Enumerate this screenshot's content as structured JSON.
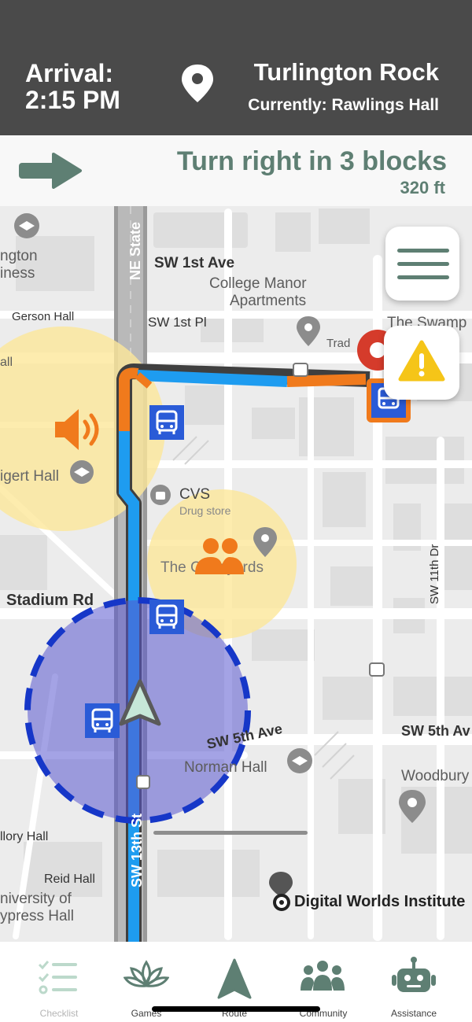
{
  "header": {
    "arrival_label": "Arrival:",
    "arrival_time": "2:15 PM",
    "destination": "Turlington Rock",
    "current": "Currently: Rawlings Hall"
  },
  "instruction": {
    "text": "Turn right in 3 blocks",
    "distance": "320 ft"
  },
  "map": {
    "labels": {
      "ne_state": "NE State",
      "sw_1st_ave": "SW 1st Ave",
      "college_manor_1": "College Manor",
      "college_manor_2": "Apartments",
      "gerson_hall": "Gerson Hall",
      "sw_1st_pl": "SW 1st Pl",
      "the_swamp": "The Swamp",
      "trad": "Trad",
      "cvs": "CVS",
      "drug_store": "Drug store",
      "the_courtyards": "The Courtyards",
      "stadium_rd": "Stadium Rd",
      "sw_11th_dr": "SW 11th Dr",
      "sw_5th_ave_a": "SW 5th Ave",
      "sw_5th_ave_b": "SW 5th Av",
      "norman_hall": "Norman Hall",
      "woodbury": "Woodbury",
      "sw_13th_st": "SW 13th St",
      "mallory_hall": "llory Hall",
      "reid_hall": "Reid Hall",
      "univ_1": "niversity of",
      "univ_2": "ypress Hall",
      "digital_worlds": "Digital Worlds Institute",
      "ington": "ngton",
      "iness": "iness",
      "all": "all",
      "igert_hall": "igert Hall"
    },
    "colors": {
      "route_blue": "#1e9cf0",
      "route_orange": "#f07a1c",
      "bus_blue": "#2a5bd7",
      "sound_zone": "#fde79a",
      "crowd_zone": "#fde79a",
      "user_zone": "#6b68d8",
      "accent": "#5e7f73",
      "warning": "#f5c518"
    },
    "icons": [
      "sound-icon",
      "crowd-icon",
      "bus-icon",
      "warning-icon",
      "menu-icon",
      "navigation-arrow-icon",
      "location-pin-icon"
    ]
  },
  "nav": {
    "items": [
      {
        "label": "Checklist",
        "icon": "checklist-icon"
      },
      {
        "label": "Games",
        "icon": "lotus-icon"
      },
      {
        "label": "Route",
        "icon": "route-arrow-icon"
      },
      {
        "label": "Community",
        "icon": "community-icon"
      },
      {
        "label": "Assistance",
        "icon": "robot-icon"
      }
    ]
  }
}
